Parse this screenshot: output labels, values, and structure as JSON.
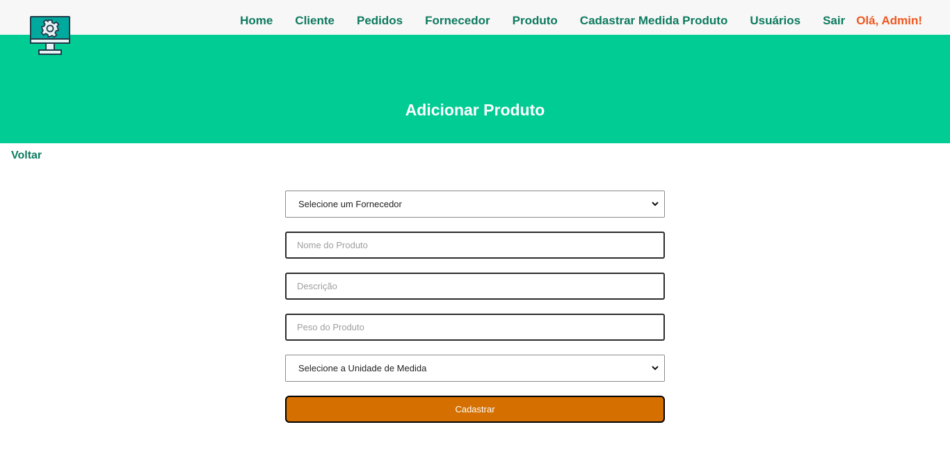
{
  "logo": {
    "icon": "monitor-gear-icon",
    "accent": "#00a99d"
  },
  "nav": {
    "items": [
      {
        "label": "Home"
      },
      {
        "label": "Cliente"
      },
      {
        "label": "Pedidos"
      },
      {
        "label": "Fornecedor"
      },
      {
        "label": "Produto"
      },
      {
        "label": "Cadastrar Medida Produto"
      },
      {
        "label": "Usuários"
      },
      {
        "label": "Sair"
      }
    ],
    "greeting": "Olá, Admin!"
  },
  "hero": {
    "title": "Adicionar Produto"
  },
  "back_link": "Voltar",
  "form": {
    "supplier_select": {
      "selected": "Selecione um Fornecedor"
    },
    "product_name": {
      "placeholder": "Nome do Produto",
      "value": ""
    },
    "description": {
      "placeholder": "Descrição",
      "value": ""
    },
    "weight": {
      "placeholder": "Peso do Produto",
      "value": ""
    },
    "unit_select": {
      "selected": "Selecione a Unidade de Medida"
    },
    "submit_label": "Cadastrar"
  },
  "colors": {
    "hero_bg": "#00cc94",
    "nav_link": "#0d7a5f",
    "greeting": "#f0571f",
    "submit_bg": "#d46f00"
  }
}
